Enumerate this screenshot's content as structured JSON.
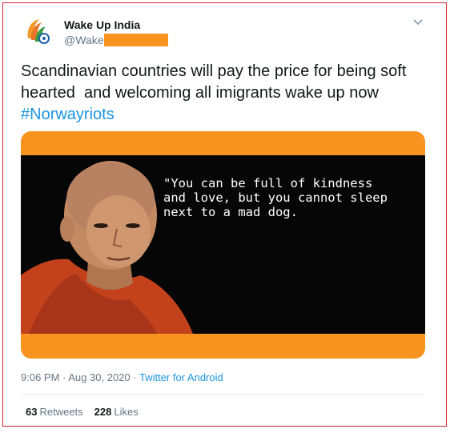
{
  "user": {
    "name": "Wake Up India",
    "handle": "@Wake"
  },
  "tweet": {
    "text": "Scandinavian countries will pay the price for being soft hearted  and welcoming all imigrants wake up now ",
    "hashtag": "#Norwayriots"
  },
  "media": {
    "quote": "\"You can be full of kindness\nand love, but you cannot sleep\nnext to a mad dog.",
    "colors": {
      "band": "#f7931e",
      "background": "#060606"
    }
  },
  "meta": {
    "time": "9:06 PM",
    "separator1": " · ",
    "date": "Aug 30, 2020",
    "separator2": " · ",
    "source": "Twitter for Android"
  },
  "stats": {
    "retweets_count": "63",
    "retweets_label": "Retweets",
    "likes_count": "228",
    "likes_label": "Likes"
  },
  "icons": {
    "menu": "chevron-down-icon",
    "avatar": "flag-logo"
  },
  "colors": {
    "accent": "#1b95e0",
    "muted": "#657786",
    "border": "#d6262d",
    "redaction": "#f7931e"
  }
}
